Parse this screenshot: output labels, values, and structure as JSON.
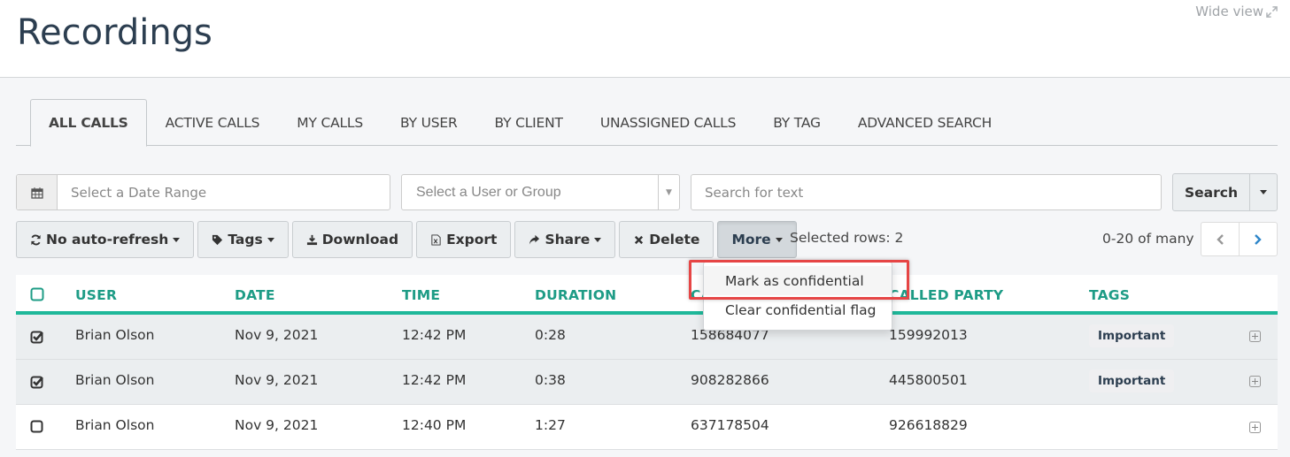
{
  "header": {
    "title": "Recordings",
    "wide_view_label": "Wide view",
    "wide_view_icon": "expand-arrows-icon"
  },
  "tabs": [
    {
      "label": "ALL CALLS",
      "active": true
    },
    {
      "label": "ACTIVE CALLS",
      "active": false
    },
    {
      "label": "MY CALLS",
      "active": false
    },
    {
      "label": "BY USER",
      "active": false
    },
    {
      "label": "BY CLIENT",
      "active": false
    },
    {
      "label": "UNASSIGNED CALLS",
      "active": false
    },
    {
      "label": "BY TAG",
      "active": false
    },
    {
      "label": "ADVANCED SEARCH",
      "active": false
    }
  ],
  "filters": {
    "date_range": {
      "placeholder": "Select a Date Range",
      "value": "",
      "icon": "calendar-icon"
    },
    "user_group": {
      "placeholder": "Select a User or Group",
      "value": ""
    },
    "text_search": {
      "placeholder": "Search for text",
      "value": ""
    },
    "search_button_label": "Search"
  },
  "toolbar": {
    "auto_refresh_label": "No auto-refresh",
    "tags_label": "Tags",
    "download_label": "Download",
    "export_label": "Export",
    "share_label": "Share",
    "delete_label": "Delete",
    "more_label": "More",
    "selected_rows_text": "Selected rows: 2",
    "pager_text": "0-20 of many"
  },
  "more_menu": {
    "items": [
      "Mark as confidential",
      "Clear confidential flag"
    ],
    "highlighted_index": 0
  },
  "table": {
    "columns": [
      "USER",
      "DATE",
      "TIME",
      "DURATION",
      "CALLING PARTY",
      "CALLED PARTY",
      "TAGS"
    ],
    "rows": [
      {
        "selected": true,
        "user": "Brian Olson",
        "date": "Nov 9, 2021",
        "time": "12:42 PM",
        "duration": "0:28",
        "calling": "158684077",
        "called": "159992013",
        "tag": "Important"
      },
      {
        "selected": true,
        "user": "Brian Olson",
        "date": "Nov 9, 2021",
        "time": "12:42 PM",
        "duration": "0:38",
        "calling": "908282866",
        "called": "445800501",
        "tag": "Important"
      },
      {
        "selected": false,
        "user": "Brian Olson",
        "date": "Nov 9, 2021",
        "time": "12:40 PM",
        "duration": "1:27",
        "calling": "637178504",
        "called": "926618829",
        "tag": ""
      }
    ]
  },
  "colors": {
    "accent": "#1fb89a",
    "header_text": "#1e9c86",
    "title": "#2c3e50",
    "highlight_box": "#e64545",
    "pager_next": "#2e86c9"
  }
}
